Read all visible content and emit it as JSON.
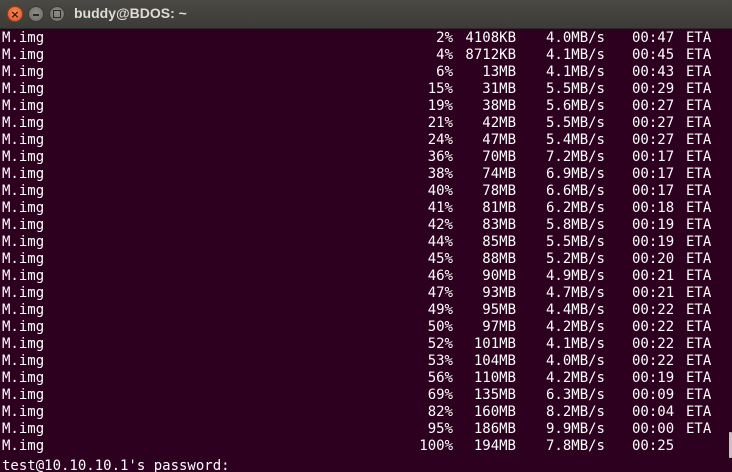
{
  "window": {
    "title": "buddy@BDOS: ~",
    "buttons": {
      "close": "×",
      "minimize": "",
      "maximize": ""
    },
    "colors": {
      "terminal_bg": "#2c001e",
      "titlebar_bg": "#3c3b37",
      "text": "#ffffff",
      "close_button": "#e0531f"
    }
  },
  "transfer_rows": [
    {
      "file": "M.img",
      "percent": "2%",
      "size": "4108KB",
      "rate": "4.0MB/s",
      "time": "00:47",
      "eta": "ETA"
    },
    {
      "file": "M.img",
      "percent": "4%",
      "size": "8712KB",
      "rate": "4.1MB/s",
      "time": "00:45",
      "eta": "ETA"
    },
    {
      "file": "M.img",
      "percent": "6%",
      "size": "13MB",
      "rate": "4.1MB/s",
      "time": "00:43",
      "eta": "ETA"
    },
    {
      "file": "M.img",
      "percent": "15%",
      "size": "31MB",
      "rate": "5.5MB/s",
      "time": "00:29",
      "eta": "ETA"
    },
    {
      "file": "M.img",
      "percent": "19%",
      "size": "38MB",
      "rate": "5.6MB/s",
      "time": "00:27",
      "eta": "ETA"
    },
    {
      "file": "M.img",
      "percent": "21%",
      "size": "42MB",
      "rate": "5.5MB/s",
      "time": "00:27",
      "eta": "ETA"
    },
    {
      "file": "M.img",
      "percent": "24%",
      "size": "47MB",
      "rate": "5.4MB/s",
      "time": "00:27",
      "eta": "ETA"
    },
    {
      "file": "M.img",
      "percent": "36%",
      "size": "70MB",
      "rate": "7.2MB/s",
      "time": "00:17",
      "eta": "ETA"
    },
    {
      "file": "M.img",
      "percent": "38%",
      "size": "74MB",
      "rate": "6.9MB/s",
      "time": "00:17",
      "eta": "ETA"
    },
    {
      "file": "M.img",
      "percent": "40%",
      "size": "78MB",
      "rate": "6.6MB/s",
      "time": "00:17",
      "eta": "ETA"
    },
    {
      "file": "M.img",
      "percent": "41%",
      "size": "81MB",
      "rate": "6.2MB/s",
      "time": "00:18",
      "eta": "ETA"
    },
    {
      "file": "M.img",
      "percent": "42%",
      "size": "83MB",
      "rate": "5.8MB/s",
      "time": "00:19",
      "eta": "ETA"
    },
    {
      "file": "M.img",
      "percent": "44%",
      "size": "85MB",
      "rate": "5.5MB/s",
      "time": "00:19",
      "eta": "ETA"
    },
    {
      "file": "M.img",
      "percent": "45%",
      "size": "88MB",
      "rate": "5.2MB/s",
      "time": "00:20",
      "eta": "ETA"
    },
    {
      "file": "M.img",
      "percent": "46%",
      "size": "90MB",
      "rate": "4.9MB/s",
      "time": "00:21",
      "eta": "ETA"
    },
    {
      "file": "M.img",
      "percent": "47%",
      "size": "93MB",
      "rate": "4.7MB/s",
      "time": "00:21",
      "eta": "ETA"
    },
    {
      "file": "M.img",
      "percent": "49%",
      "size": "95MB",
      "rate": "4.4MB/s",
      "time": "00:22",
      "eta": "ETA"
    },
    {
      "file": "M.img",
      "percent": "50%",
      "size": "97MB",
      "rate": "4.2MB/s",
      "time": "00:22",
      "eta": "ETA"
    },
    {
      "file": "M.img",
      "percent": "52%",
      "size": "101MB",
      "rate": "4.1MB/s",
      "time": "00:22",
      "eta": "ETA"
    },
    {
      "file": "M.img",
      "percent": "53%",
      "size": "104MB",
      "rate": "4.0MB/s",
      "time": "00:22",
      "eta": "ETA"
    },
    {
      "file": "M.img",
      "percent": "56%",
      "size": "110MB",
      "rate": "4.2MB/s",
      "time": "00:19",
      "eta": "ETA"
    },
    {
      "file": "M.img",
      "percent": "69%",
      "size": "135MB",
      "rate": "6.3MB/s",
      "time": "00:09",
      "eta": "ETA"
    },
    {
      "file": "M.img",
      "percent": "82%",
      "size": "160MB",
      "rate": "8.2MB/s",
      "time": "00:04",
      "eta": "ETA"
    },
    {
      "file": "M.img",
      "percent": "95%",
      "size": "186MB",
      "rate": "9.9MB/s",
      "time": "00:00",
      "eta": "ETA"
    },
    {
      "file": "M.img",
      "percent": "100%",
      "size": "194MB",
      "rate": "7.8MB/s",
      "time": "00:25",
      "eta": ""
    }
  ],
  "prompt": {
    "text": "test@10.10.10.1's password:"
  }
}
